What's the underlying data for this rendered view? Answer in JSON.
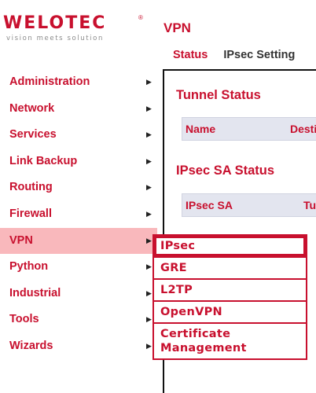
{
  "logo": {
    "wordmark": "WELOTEC",
    "registered": "®",
    "tagline": "vision meets solution"
  },
  "header": {
    "title": "VPN",
    "tabs": [
      "Status",
      "IPsec Setting"
    ]
  },
  "sidebar": {
    "items": [
      {
        "label": "Administration"
      },
      {
        "label": "Network"
      },
      {
        "label": "Services"
      },
      {
        "label": "Link Backup"
      },
      {
        "label": "Routing"
      },
      {
        "label": "Firewall"
      },
      {
        "label": "VPN",
        "active": true
      },
      {
        "label": "Python"
      },
      {
        "label": "Industrial"
      },
      {
        "label": "Tools"
      },
      {
        "label": "Wizards"
      }
    ],
    "arrow": "▶"
  },
  "main": {
    "tunnel_status": {
      "title": "Tunnel Status",
      "columns": [
        "Name",
        "Desti"
      ]
    },
    "ipsec_sa_status": {
      "title": "IPsec SA Status",
      "columns": [
        "IPsec SA",
        "Tu"
      ]
    }
  },
  "submenu": {
    "items": [
      "IPsec",
      "GRE",
      "L2TP",
      "OpenVPN",
      "Certificate Management"
    ],
    "selected": "IPsec"
  },
  "colors": {
    "brand": "#c8102e",
    "active_bg": "#f9b8bc",
    "table_header_bg": "#e3e5ef"
  }
}
